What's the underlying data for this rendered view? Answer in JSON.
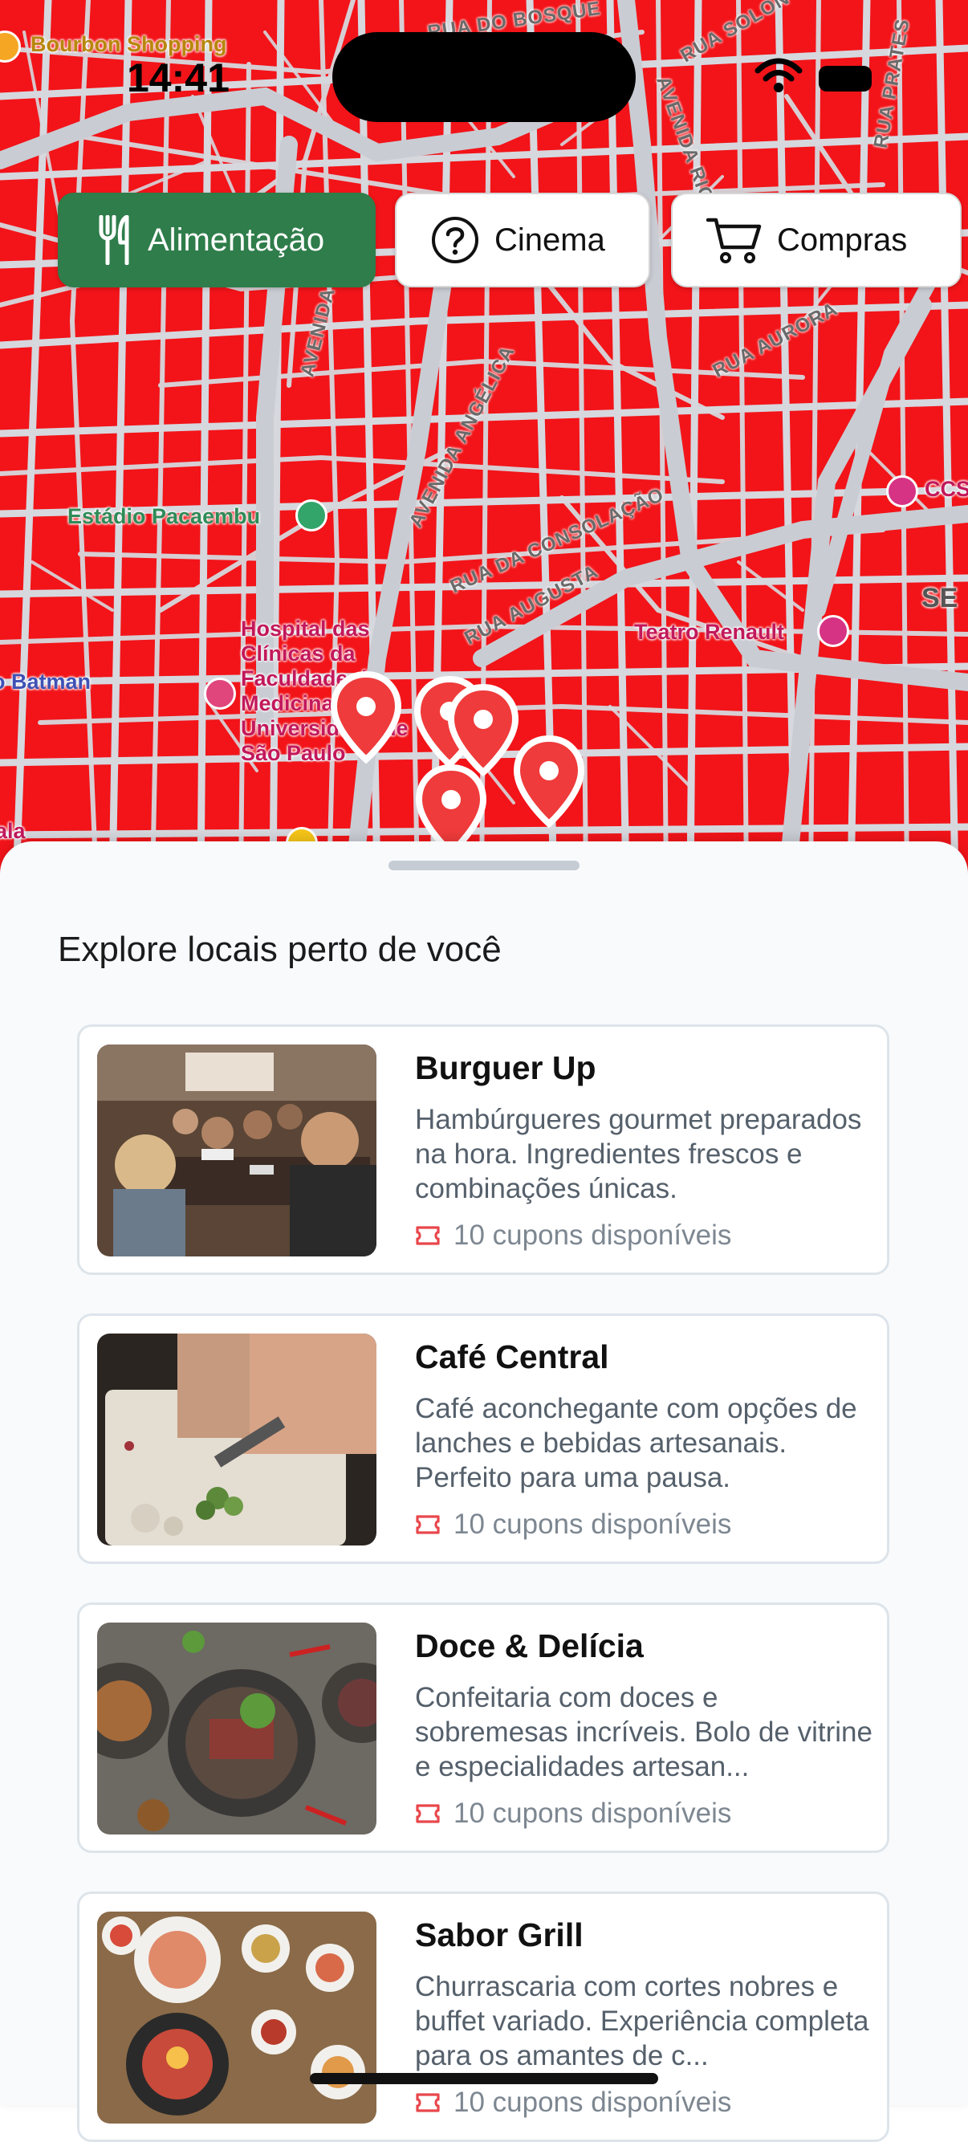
{
  "status_bar": {
    "time": "14:41"
  },
  "map": {
    "labels": {
      "shopping": "Bourbon Shopping",
      "stadium": "Estádio Pacaembu",
      "hospital": "Hospital das Clínicas da Faculdade de Medicina da Universidade de São Paulo",
      "batman": "o Batman",
      "theater": "Teatro Renault",
      "ccsp": "CCS",
      "se": "SE",
      "sala": "ala"
    },
    "roads": {
      "rua_do_bosque": "RUA DO BOSQUE",
      "avenida_rio": "AVENIDA RIO",
      "rua_solon": "RUA SOLON",
      "rua_prates": "RUA PRATES",
      "rua_aurora": "RUA AURORA",
      "avenida": "AVENIDA",
      "avenida_angelica": "AVENIDA ANGÉLICA",
      "rua_consolacao": "RUA DA CONSOLAÇÃO",
      "rua_augusta": "RUA AUGUSTA"
    },
    "colors": {
      "land": "#f21419",
      "roads": "#d2d5dc",
      "marker": "#ef3b3b"
    }
  },
  "filters": [
    {
      "label": "Alimentação",
      "icon": "fork-knife-icon",
      "active": true
    },
    {
      "label": "Cinema",
      "icon": "question-circle-icon",
      "active": false
    },
    {
      "label": "Compras",
      "icon": "cart-icon",
      "active": false
    }
  ],
  "sheet": {
    "title": "Explore locais perto de você",
    "places": [
      {
        "name": "Burguer Up",
        "description": "Hambúrgueres gourmet preparados na hora. Ingredientes frescos e combinações únicas.",
        "coupons": "10 cupons disponíveis"
      },
      {
        "name": "Café Central",
        "description": "Café aconchegante com opções de lanches e bebidas artesanais. Perfeito para uma pausa.",
        "coupons": "10 cupons disponíveis"
      },
      {
        "name": "Doce & Delícia",
        "description": "Confeitaria com doces e sobremesas incríveis. Bolo de vitrine e especialidades artesan...",
        "coupons": "10 cupons disponíveis"
      },
      {
        "name": "Sabor Grill",
        "description": "Churrascaria com cortes nobres e buffet variado. Experiência completa para os amantes de c...",
        "coupons": "10 cupons disponíveis"
      }
    ]
  },
  "colors": {
    "accent_green": "#2e7d4a",
    "coupon_red": "#e8474c"
  }
}
